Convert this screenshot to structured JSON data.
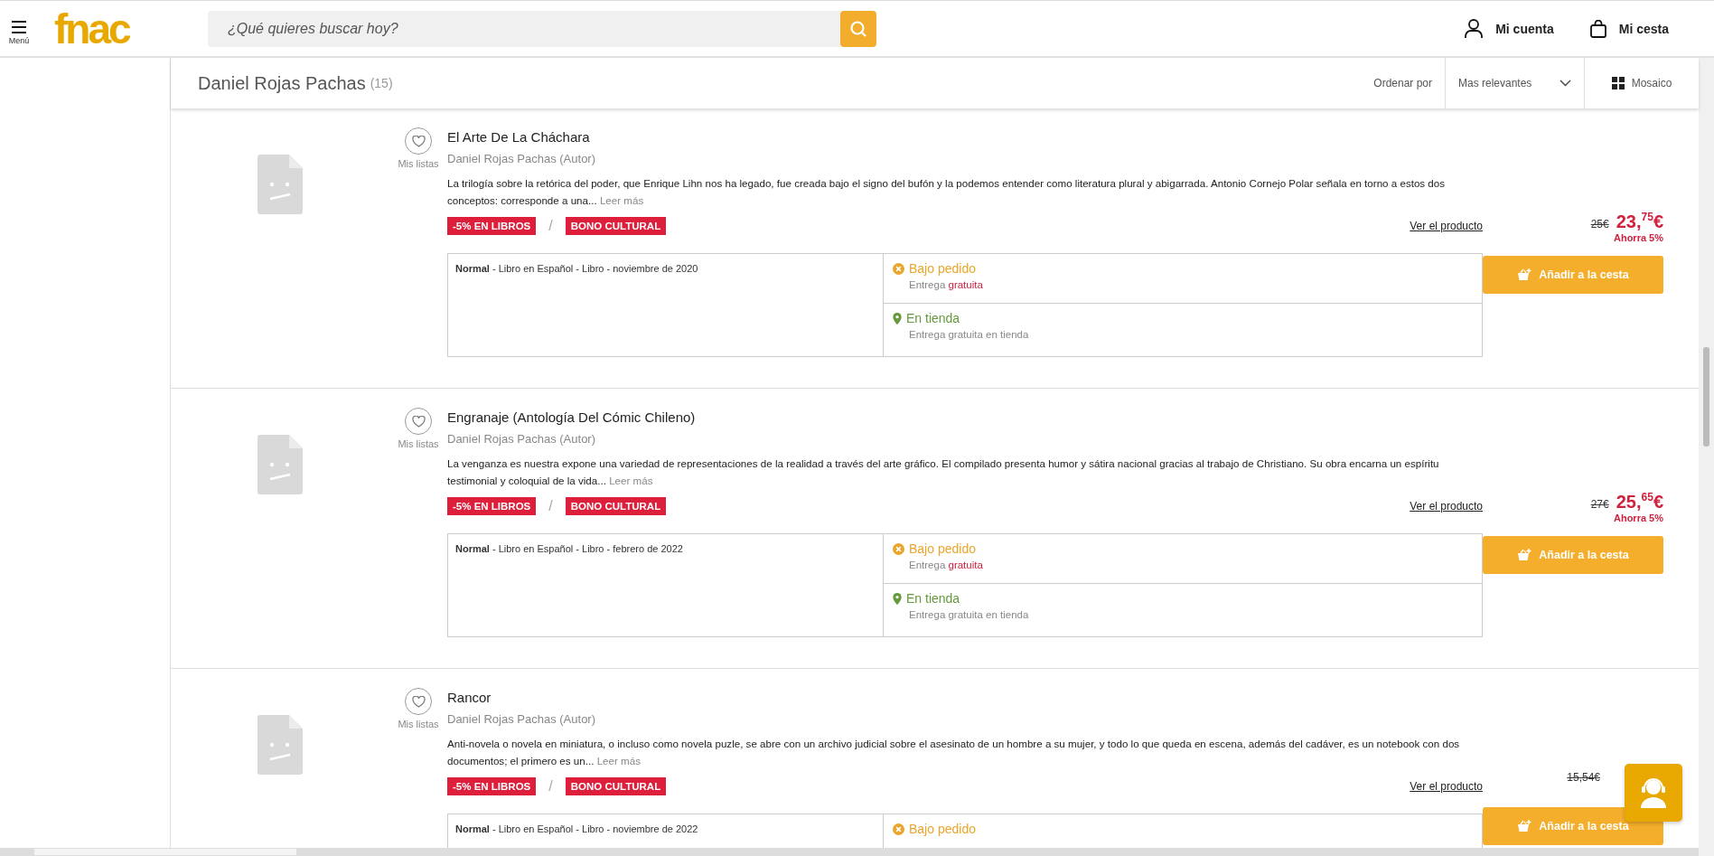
{
  "header": {
    "menu_label": "Menú",
    "logo": "fnac",
    "search": {
      "placeholder": "¿Qué quieres buscar hoy?"
    },
    "account": "Mi cuenta",
    "cart": "Mi cesta"
  },
  "results_bar": {
    "title": "Daniel Rojas Pachas",
    "count": "(15)",
    "sort_label": "Ordenar por",
    "sort_value": "Mas relevantes",
    "view": "Mosaico"
  },
  "products": [
    {
      "title": "El Arte De La Cháchara",
      "author": "Daniel Rojas Pachas (Autor)",
      "wishlist": "Mis listas",
      "description": "La trilogía sobre la retórica del poder, que Enrique Lihn nos ha legado, fue creada bajo el signo del bufón y la podemos entender como literatura plural y abigarrada. Antonio Cornejo Polar señala en torno a estos dos conceptos: corresponde a una...",
      "read_more": "Leer más",
      "badges": [
        "-5% EN LIBROS",
        "BONO CULTURAL"
      ],
      "badge_separator": "/",
      "link": "Ver el producto",
      "format": "**Normal** - Libro en Español - Libro - noviembre de 2020",
      "availability": [
        {
          "kind": "order",
          "status": "Bajo pedido",
          "note": "Entrega",
          "note_highlight": "gratuita"
        },
        {
          "kind": "store",
          "status": "En tienda",
          "note": "Entrega gratuita en tienda"
        }
      ],
      "old_price": "25€",
      "price": "23,$^{75}$€",
      "saving": "Ahorra 5%",
      "cart_button": "Añadir a la cesta"
    },
    {
      "title": "Engranaje (Antología Del Cómic Chileno)",
      "author": "Daniel Rojas Pachas (Autor)",
      "wishlist": "Mis listas",
      "description": "La venganza es nuestra expone una variedad de representaciones de la realidad a través del arte gráfico. El compilado presenta humor y sátira nacional gracias al trabajo de Christiano. Su obra encarna un espíritu testimonial y coloquial de la vida...",
      "read_more": "Leer más",
      "badges": [
        "-5% EN LIBROS",
        "BONO CULTURAL"
      ],
      "badge_separator": "/",
      "link": "Ver el producto",
      "format": "**Normal** - Libro en Español - Libro - febrero de 2022",
      "availability": [
        {
          "kind": "order",
          "status": "Bajo pedido",
          "note": "Entrega",
          "note_highlight": "gratuita"
        },
        {
          "kind": "store",
          "status": "En tienda",
          "note": "Entrega gratuita en tienda"
        }
      ],
      "old_price": "27€",
      "price": "25,$^{65}$€",
      "saving": "Ahorra 5%",
      "cart_button": "Añadir a la cesta"
    },
    {
      "title": "Rancor",
      "author": "Daniel Rojas Pachas (Autor)",
      "wishlist": "Mis listas",
      "description": "Anti-novela o novela en miniatura, o incluso como novela puzle, se abre con un archivo judicial sobre el asesinato de un hombre a su mujer, y todo lo que queda en escena, además del cadáver, es un notebook con dos documentos; el primero es un...",
      "read_more": "Leer más",
      "badges": [
        "-5% EN LIBROS",
        "BONO CULTURAL"
      ],
      "badge_separator": "/",
      "link": "Ver el producto",
      "format": "**Normal** - Libro en Español - Libro - noviembre de 2022",
      "availability": [
        {
          "kind": "order",
          "status": "Bajo pedido"
        }
      ],
      "old_price": "15,54€",
      "cart_button": "Añadir a la cesta"
    }
  ]
}
